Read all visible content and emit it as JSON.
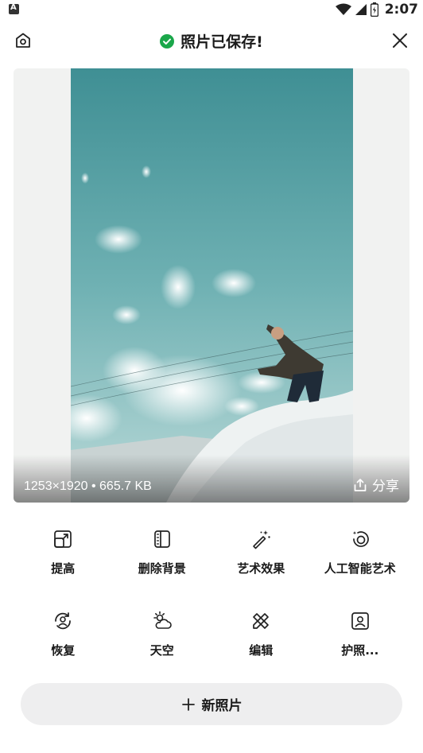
{
  "status_bar": {
    "time": "2:07"
  },
  "header": {
    "title": "照片已保存!"
  },
  "preview": {
    "meta": "1253×1920 • 665.7 KB",
    "share_label": "分享"
  },
  "tools": [
    {
      "label": "提高",
      "icon": "enhance-icon"
    },
    {
      "label": "删除背景",
      "icon": "remove-background-icon"
    },
    {
      "label": "艺术效果",
      "icon": "magic-wand-icon"
    },
    {
      "label": "人工智能艺术",
      "icon": "ai-art-icon"
    },
    {
      "label": "恢复",
      "icon": "restore-face-icon"
    },
    {
      "label": "天空",
      "icon": "sky-icon"
    },
    {
      "label": "编辑",
      "icon": "edit-tools-icon"
    },
    {
      "label": "护照...",
      "icon": "passport-icon"
    }
  ],
  "new_photo": {
    "label": "新照片"
  },
  "colors": {
    "success": "#1aa74a",
    "button_bg": "#eeeeef",
    "sky": "#4f9aa0"
  }
}
